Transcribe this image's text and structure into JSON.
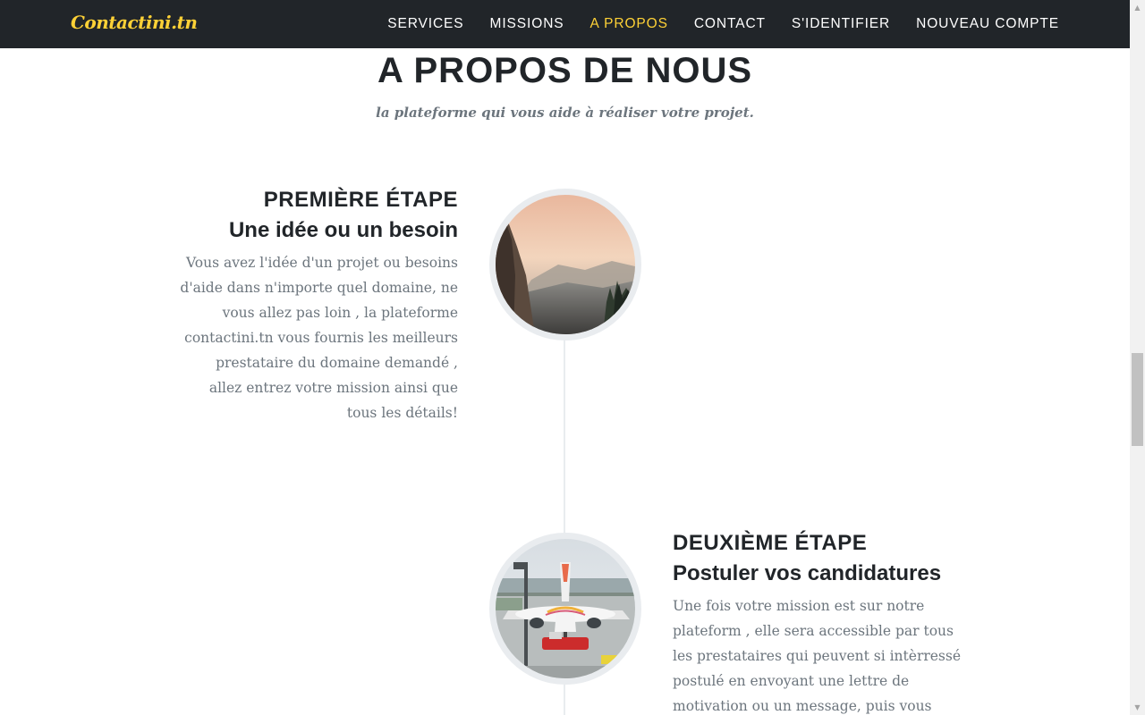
{
  "navbar": {
    "brand": "Contactini.tn",
    "links": [
      {
        "label": "SERVICES",
        "active": false
      },
      {
        "label": "MISSIONS",
        "active": false
      },
      {
        "label": "A PROPOS",
        "active": true
      },
      {
        "label": "CONTACT",
        "active": false
      },
      {
        "label": "S'IDENTIFIER",
        "active": false
      },
      {
        "label": "NOUVEAU COMPTE",
        "active": false
      }
    ]
  },
  "about": {
    "heading": "A PROPOS DE NOUS",
    "subheading": "la plateforme qui vous aide à réaliser votre projet."
  },
  "timeline": [
    {
      "step": "PREMIÈRE ÉTAPE",
      "title": "Une idée ou un besoin",
      "body": "Vous avez l'idée d'un projet ou besoins d'aide dans n'importe quel domaine, ne vous allez pas loin , la plateforme contactini.tn vous fournis les meilleurs prestataire du domaine demandé , allez entrez votre mission ainsi que tous les détails!",
      "image": "mountain-valley-photo"
    },
    {
      "step": "DEUXIÈME ÉTAPE",
      "title": "Postuler vos candidatures",
      "body": "Une fois votre mission est sur notre plateform , elle sera accessible par tous les prestataires qui peuvent si intèrressé postulé en envoyant une lettre de motivation ou un message, puis vous",
      "image": "airplane-airport-photo"
    }
  ],
  "colors": {
    "navbar_bg": "#212529",
    "accent": "#fed136",
    "heading": "#212529",
    "muted_text": "#6c757d",
    "timeline": "#e9ecef"
  }
}
